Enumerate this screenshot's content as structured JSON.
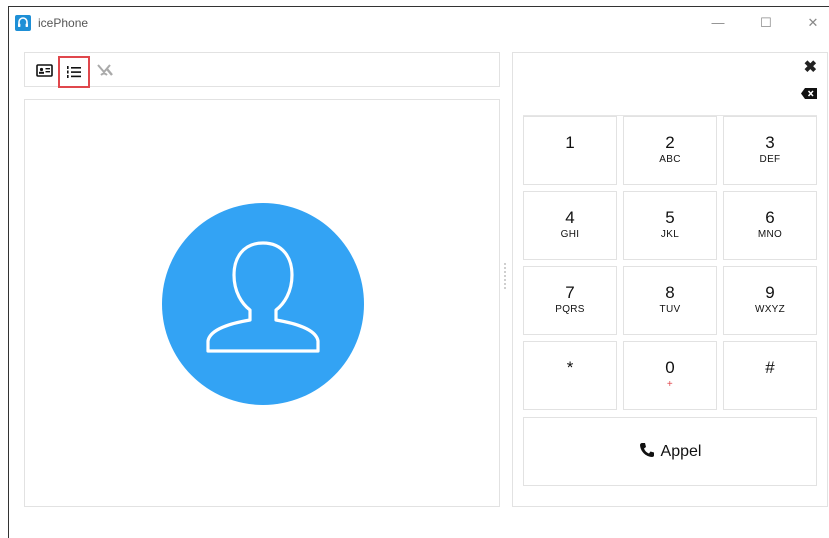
{
  "window": {
    "title": "icePhone",
    "minimize_glyph": "—",
    "maximize_glyph": "☐",
    "close_glyph": "✕"
  },
  "toolbar": {
    "items": [
      {
        "icon": "contact-card-icon",
        "selected": false
      },
      {
        "icon": "numbered-list-icon",
        "selected": true
      },
      {
        "icon": "missed-call-icon",
        "selected": false
      }
    ]
  },
  "dialpad": {
    "close_glyph": "✖",
    "keys": [
      {
        "digit": "1",
        "letters": ""
      },
      {
        "digit": "2",
        "letters": "ABC"
      },
      {
        "digit": "3",
        "letters": "DEF"
      },
      {
        "digit": "4",
        "letters": "GHI"
      },
      {
        "digit": "5",
        "letters": "JKL"
      },
      {
        "digit": "6",
        "letters": "MNO"
      },
      {
        "digit": "7",
        "letters": "PQRS"
      },
      {
        "digit": "8",
        "letters": "TUV"
      },
      {
        "digit": "9",
        "letters": "WXYZ"
      },
      {
        "digit": "*",
        "letters": ""
      },
      {
        "digit": "0",
        "letters": "+"
      },
      {
        "digit": "#",
        "letters": ""
      }
    ],
    "call_label": "Appel"
  },
  "colors": {
    "accent": "#1e8fd6",
    "avatar": "#33a3f4",
    "selected_border": "#e0474c"
  }
}
